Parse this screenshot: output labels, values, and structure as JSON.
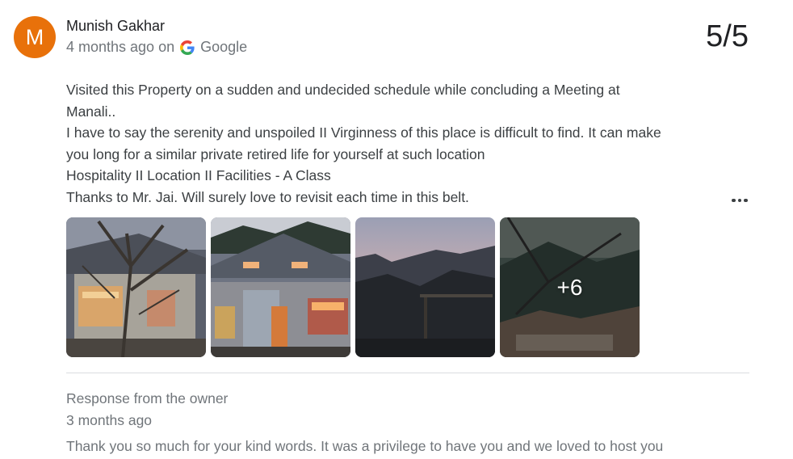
{
  "review": {
    "avatar_letter": "M",
    "avatar_color": "#e8710a",
    "author": "Munish Gakhar",
    "time": "4 months ago on",
    "source_icon": "google-g-icon",
    "source": "Google",
    "rating": "5/5",
    "text_lines": [
      "Visited this Property on a sudden and undecided schedule while concluding a Meeting at",
      "Manali..",
      "I have to say the serenity and unspoiled II Virginness of this place is difficult to find. It can make",
      "you long for a similar private retired life for yourself at such location",
      "Hospitality II Location II Facilities - A Class",
      "Thanks to Mr. Jai. Will surely love to revisit each time in this belt."
    ],
    "more_icon": "more-horiz-icon",
    "photos_more_label": "+6"
  },
  "owner_response": {
    "title": "Response from the owner",
    "time": "3 months ago",
    "text": "Thank you so much for your kind words. It was a privilege to have you and we loved to host you"
  }
}
